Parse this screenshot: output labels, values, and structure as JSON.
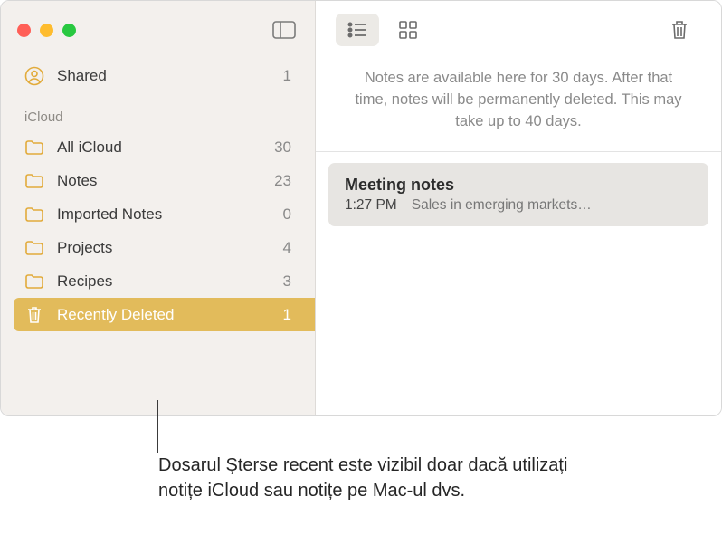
{
  "sidebar": {
    "shared_label": "Shared",
    "shared_count": "1",
    "section": "iCloud",
    "folders": [
      {
        "name": "All iCloud",
        "count": "30"
      },
      {
        "name": "Notes",
        "count": "23"
      },
      {
        "name": "Imported Notes",
        "count": "0"
      },
      {
        "name": "Projects",
        "count": "4"
      },
      {
        "name": "Recipes",
        "count": "3"
      }
    ],
    "deleted": {
      "name": "Recently Deleted",
      "count": "1"
    }
  },
  "main": {
    "info": "Notes are available here for 30 days. After that time, notes will be permanently deleted. This may take up to 40 days.",
    "note": {
      "title": "Meeting notes",
      "time": "1:27 PM",
      "snippet": "Sales in emerging markets…"
    }
  },
  "callout": "Dosarul Șterse recent este vizibil doar dacă utilizați notițe iCloud sau notițe pe Mac-ul dvs."
}
